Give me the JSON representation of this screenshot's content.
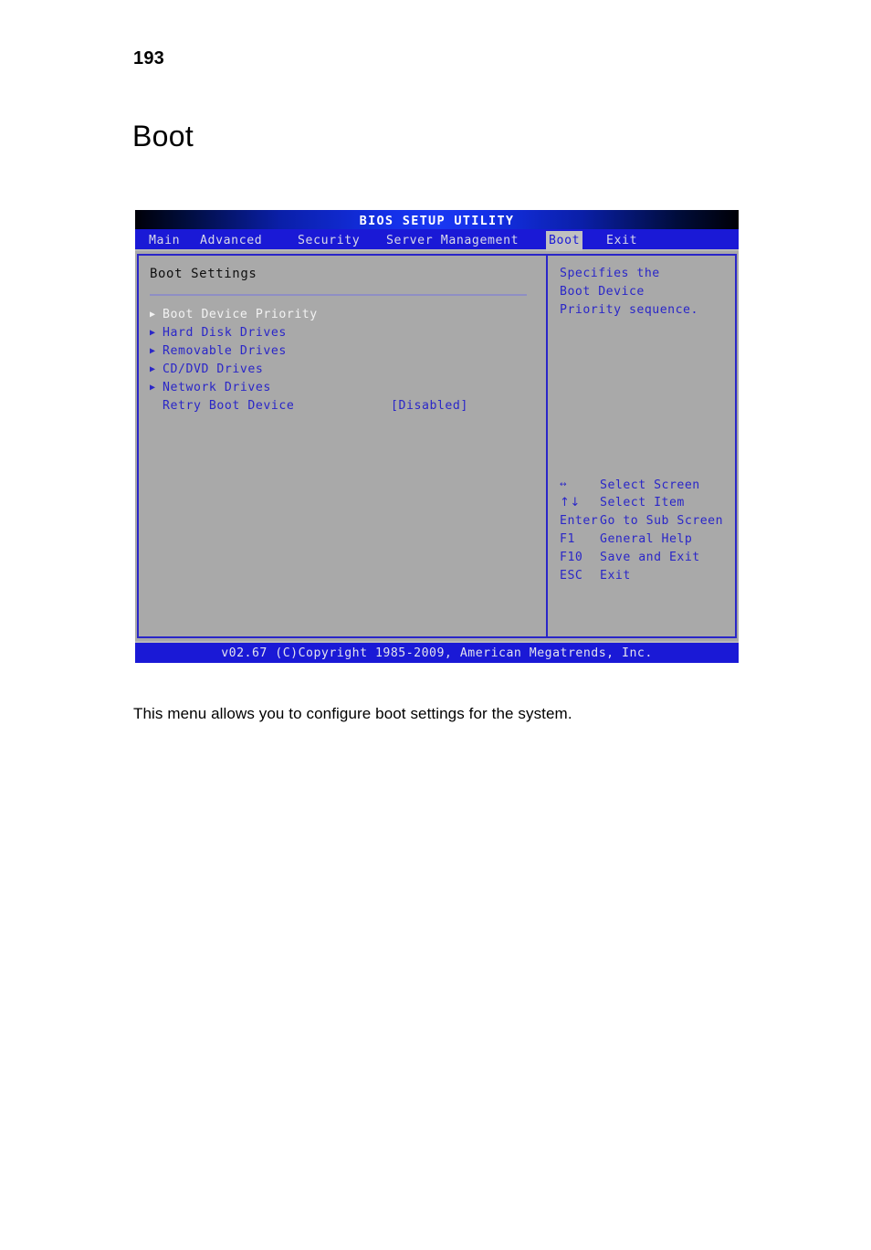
{
  "document": {
    "page_number": "193",
    "heading": "Boot",
    "caption": "This menu allows you to configure boot settings for the system."
  },
  "bios": {
    "title": "BIOS SETUP UTILITY",
    "menu": [
      {
        "label": "Main",
        "selected": false
      },
      {
        "label": "Advanced",
        "selected": false
      },
      {
        "label": "Security",
        "selected": false
      },
      {
        "label": "Server Management",
        "selected": false
      },
      {
        "label": "Boot",
        "selected": true
      },
      {
        "label": "Exit",
        "selected": false
      }
    ],
    "section_title": "Boot Settings",
    "options": [
      {
        "arrow": "▶",
        "label": "Boot Device Priority",
        "value": "",
        "selected": true
      },
      {
        "arrow": "▶",
        "label": "Hard Disk Drives",
        "value": "",
        "selected": false
      },
      {
        "arrow": "▶",
        "label": "Removable Drives",
        "value": "",
        "selected": false
      },
      {
        "arrow": "▶",
        "label": "CD/DVD Drives",
        "value": "",
        "selected": false
      },
      {
        "arrow": "▶",
        "label": "Network Drives",
        "value": "",
        "selected": false
      },
      {
        "arrow": "",
        "label": "Retry Boot Device",
        "value": "[Disabled]",
        "selected": false
      }
    ],
    "help": {
      "lines": [
        "Specifies the",
        "Boot Device",
        "Priority sequence."
      ]
    },
    "keys": [
      {
        "key": "↔",
        "desc": "Select Screen",
        "glyph": true,
        "small": true
      },
      {
        "key": "↑↓",
        "desc": "Select Item",
        "glyph": true,
        "small": false
      },
      {
        "key": "Enter",
        "desc": "Go to Sub Screen",
        "glyph": false,
        "small": false
      },
      {
        "key": "F1",
        "desc": "General Help",
        "glyph": false,
        "small": false
      },
      {
        "key": "F10",
        "desc": "Save and Exit",
        "glyph": false,
        "small": false
      },
      {
        "key": "ESC",
        "desc": "Exit",
        "glyph": false,
        "small": false
      }
    ],
    "footer": "v02.67 (C)Copyright 1985-2009, American Megatrends, Inc.",
    "colors": {
      "accent_blue": "#2a26c8",
      "menu_blue": "#1a19d6",
      "panel_gray": "#a9a9a9",
      "selected_text": "#f2f2f2",
      "rule": "#8f8fc4"
    }
  }
}
